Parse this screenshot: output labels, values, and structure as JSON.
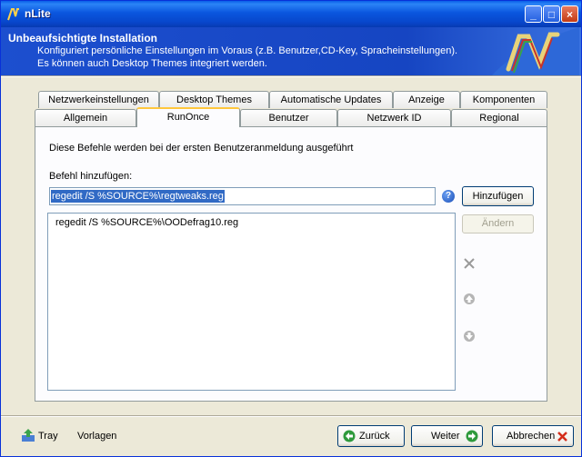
{
  "window": {
    "title": "nLite",
    "minimize": "_",
    "maximize": "□",
    "close": "×"
  },
  "banner": {
    "title": "Unbeaufsichtigte Installation",
    "line1": "Konfiguriert persönliche Einstellungen im Voraus (z.B. Benutzer,CD-Key, Spracheinstellungen).",
    "line2": "Es können auch Desktop Themes integriert werden."
  },
  "tabs": {
    "row1": [
      "Netzwerkeinstellungen",
      "Desktop Themes",
      "Automatische Updates",
      "Anzeige",
      "Komponenten"
    ],
    "row2": [
      "Allgemein",
      "RunOnce",
      "Benutzer",
      "Netzwerk ID",
      "Regional"
    ],
    "active": "RunOnce"
  },
  "runonce": {
    "description": "Diese Befehle werden bei der ersten Benutzeranmeldung ausgeführt",
    "add_label": "Befehl hinzufügen:",
    "command_value": "regedit /S %SOURCE%\\regtweaks.reg",
    "add_button": "Hinzufügen",
    "edit_button": "Ändern",
    "commands": [
      "regedit /S %SOURCE%\\OODefrag10.reg"
    ]
  },
  "footer": {
    "tray": "Tray",
    "templates": "Vorlagen",
    "back": "Zurück",
    "next": "Weiter",
    "cancel": "Abbrechen"
  },
  "colors": {
    "titlebar": "#0a56de",
    "banner": "#1645c2",
    "tab_highlight": "#ffc73c",
    "selection": "#316ac5"
  }
}
